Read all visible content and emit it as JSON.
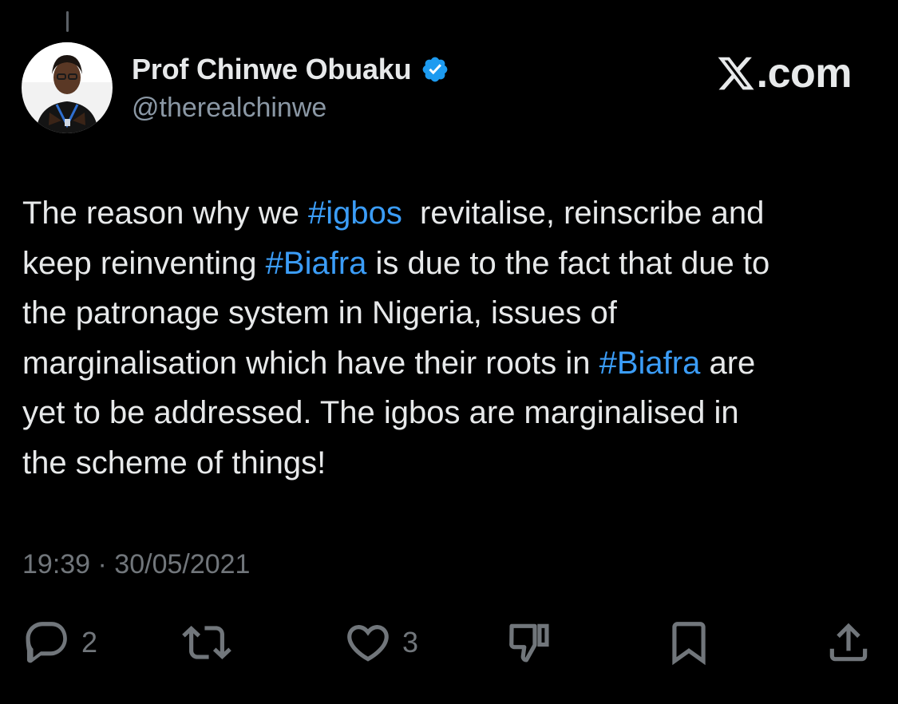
{
  "author": {
    "display_name": "Prof Chinwe Obuaku",
    "handle": "@therealchinwe",
    "verified": true
  },
  "brand": {
    "logo_text": ".com"
  },
  "tweet": {
    "lines": [
      [
        {
          "text": "The reason why we "
        },
        {
          "text": "#igbos",
          "tag": true
        },
        {
          "text": "  revitalise, reinscribe and"
        }
      ],
      [
        {
          "text": "keep reinventing "
        },
        {
          "text": "#Biafra",
          "tag": true
        },
        {
          "text": " is due to the fact that due to"
        }
      ],
      [
        {
          "text": "the patronage system in Nigeria, issues of"
        }
      ],
      [
        {
          "text": "marginalisation which have their roots in "
        },
        {
          "text": "#Biafra",
          "tag": true
        },
        {
          "text": " are"
        }
      ],
      [
        {
          "text": "yet to be addressed. The igbos are marginalised in"
        }
      ],
      [
        {
          "text": "the scheme of things!"
        }
      ]
    ],
    "timestamp": "19:39 · 30/05/2021"
  },
  "actions": {
    "reply_count": "2",
    "like_count": "3"
  },
  "colors": {
    "background": "#000000",
    "text": "#e7e9ea",
    "muted": "#71767b",
    "hashtag": "#3b9df8",
    "verified_badge": "#1d9bf0"
  },
  "icons": [
    "reply-icon",
    "retweet-icon",
    "like-icon",
    "dislike-icon",
    "bookmark-icon",
    "share-icon",
    "verified-icon",
    "x-logo-icon"
  ]
}
